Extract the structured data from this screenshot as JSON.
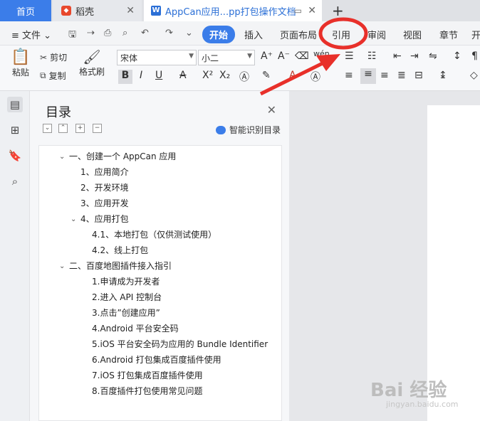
{
  "tabs": {
    "home": "首页",
    "daoke": "稻壳",
    "doc": "AppCan应用...pp打包操作文档",
    "close": "✕",
    "pin": "▭",
    "new": "+"
  },
  "menu": {
    "file": "≡ 文件 ⌄",
    "start": "开始",
    "insert": "插入",
    "layout": "页面布局",
    "ref": "引用",
    "review": "审阅",
    "view": "视图",
    "chapter": "章节",
    "extra": "开"
  },
  "ribbon": {
    "paste": "粘贴",
    "cut": "剪切",
    "copy": "复制",
    "format_painter": "格式刷",
    "font_name": "宋体",
    "font_size": "小二",
    "bold": "B",
    "italic": "I",
    "underline": "U",
    "strike": "A",
    "superscript": "X²",
    "subscript": "X₂"
  },
  "toc": {
    "title": "目录",
    "close": "✕",
    "smart_label": "智能识别目录",
    "items": [
      "一、创建一个 AppCan 应用",
      "1、应用简介",
      "2、开发环境",
      "3、应用开发",
      "4、应用打包",
      "4.1、本地打包（仅供测试使用）",
      "4.2、线上打包",
      "二、百度地图插件接入指引",
      "1.申请成为开发者",
      "2.进入 API 控制台",
      "3.点击”创建应用”",
      "4.Android 平台安全码",
      "5.iOS 平台安全码为应用的 Bundle Identifier",
      "6.Android 打包集成百度插件使用",
      "7.iOS 打包集成百度插件使用",
      "8.百度插件打包使用常见问题"
    ]
  },
  "watermark": {
    "main": "Bai 经验",
    "sub": "jingyan.baidu.com"
  },
  "colors": {
    "accent": "#3b7de9",
    "annotation": "#e8302a"
  }
}
